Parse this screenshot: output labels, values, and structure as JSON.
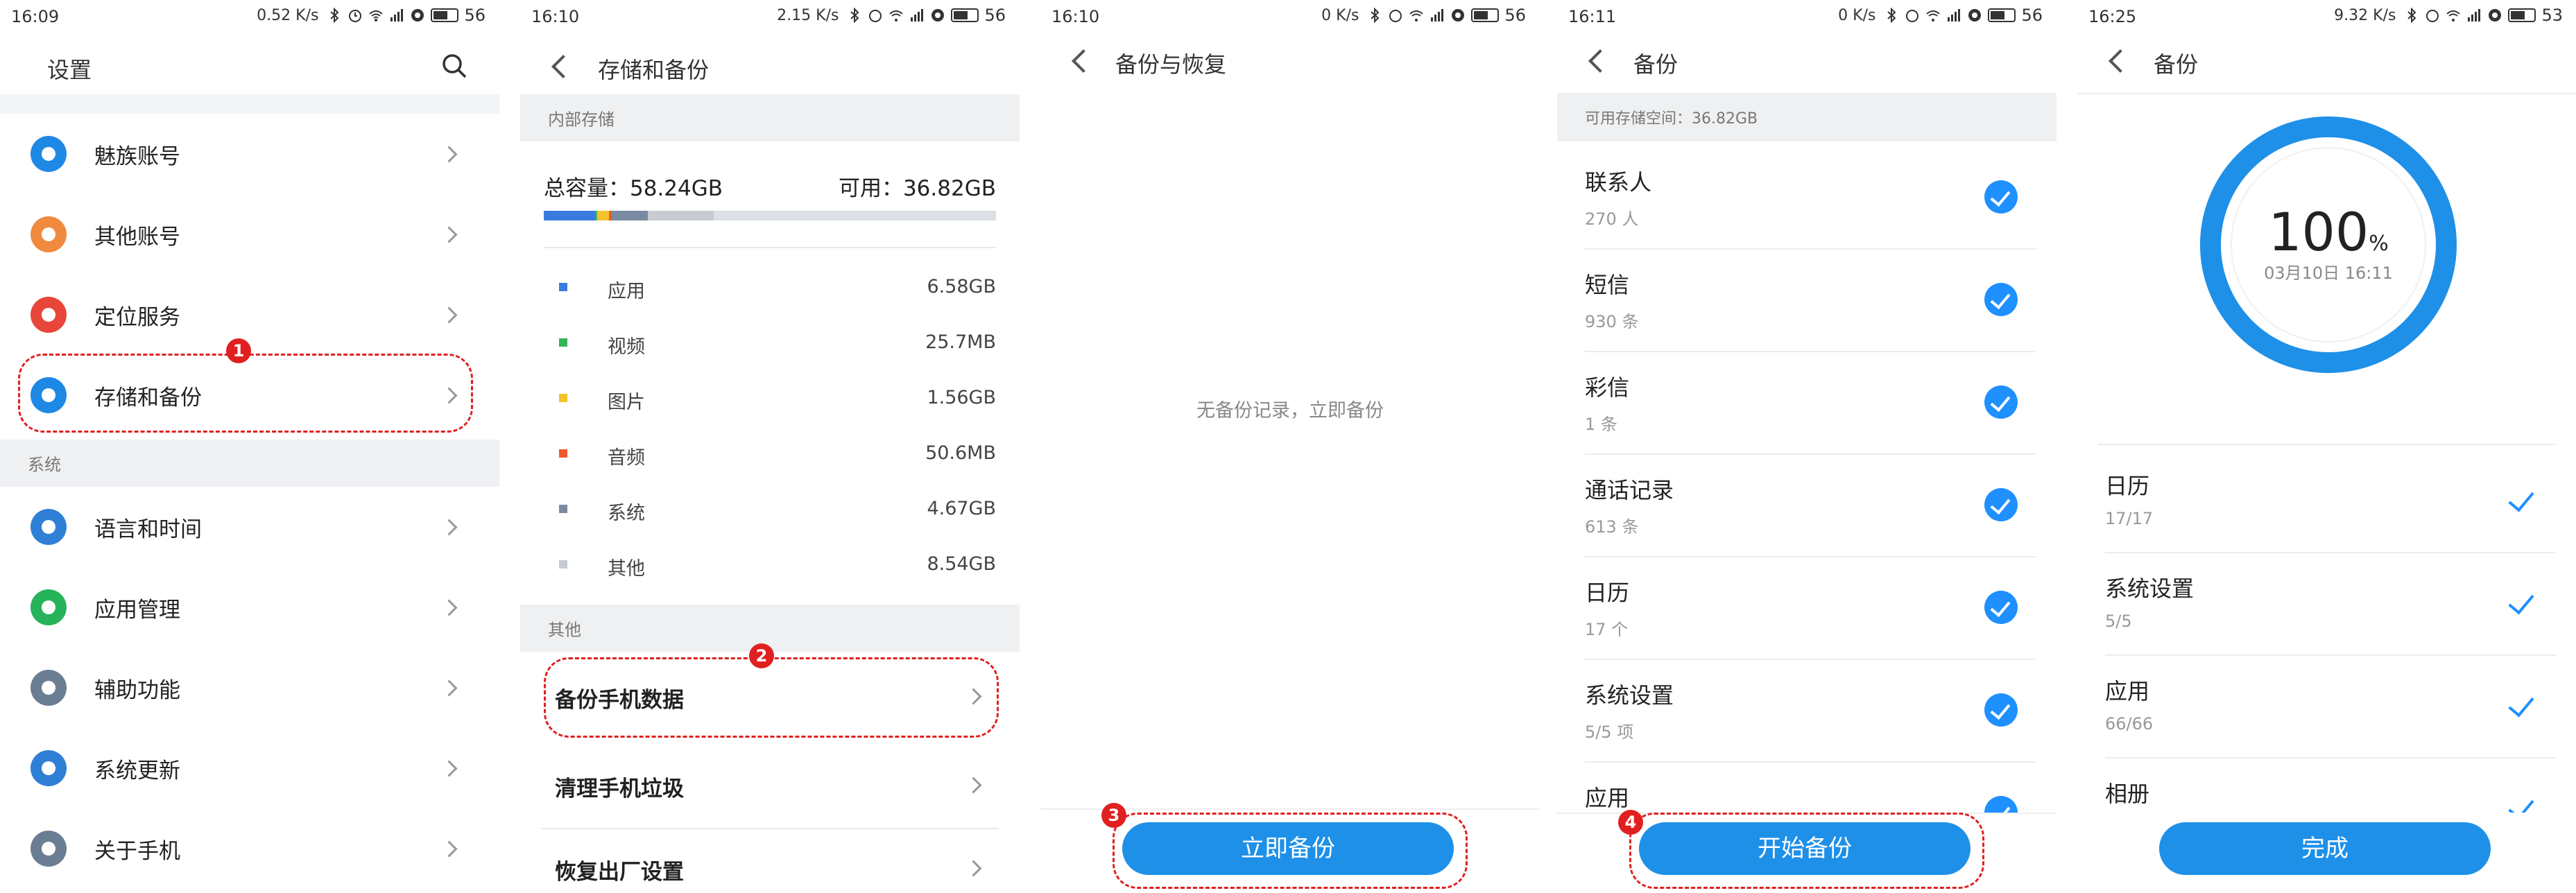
{
  "colors": {
    "accent": "#1e90e8",
    "highlight": "#e02020"
  },
  "panel1": {
    "status": {
      "time": "16:09",
      "net": "0.52 K/s",
      "battery": "56"
    },
    "title": "设置",
    "items": [
      {
        "label": "魅族账号",
        "icon": "meizu-account-icon",
        "color": "#1e88e5"
      },
      {
        "label": "其他账号",
        "icon": "person-icon",
        "color": "#f08a3e"
      },
      {
        "label": "定位服务",
        "icon": "location-pin-icon",
        "color": "#e8463a"
      },
      {
        "label": "存储和备份",
        "icon": "cloud-icon",
        "color": "#1e88e5"
      },
      {
        "label": "语言和时间",
        "icon": "globe-icon",
        "color": "#2f7fd6"
      },
      {
        "label": "应用管理",
        "icon": "app-manage-icon",
        "color": "#27b35a"
      },
      {
        "label": "辅助功能",
        "icon": "hand-pointer-icon",
        "color": "#6b7d92"
      },
      {
        "label": "系统更新",
        "icon": "refresh-icon",
        "color": "#2f7fd6"
      },
      {
        "label": "关于手机",
        "icon": "info-icon",
        "color": "#6b7d92"
      }
    ],
    "section_system": "系统",
    "badge": "1"
  },
  "panel2": {
    "status": {
      "time": "16:10",
      "net": "2.15 K/s",
      "battery": "56"
    },
    "title": "存储和备份",
    "section_internal": "内部存储",
    "total": "总容量：58.24GB",
    "available": "可用：36.82GB",
    "usage": [
      {
        "name": "应用",
        "value": "6.58GB",
        "color": "#3a7be0"
      },
      {
        "name": "视频",
        "value": "25.7MB",
        "color": "#34b55a"
      },
      {
        "name": "图片",
        "value": "1.56GB",
        "color": "#f4c22b"
      },
      {
        "name": "音频",
        "value": "50.6MB",
        "color": "#ef5a2e"
      },
      {
        "name": "系统",
        "value": "4.67GB",
        "color": "#7a8aa0"
      },
      {
        "name": "其他",
        "value": "8.54GB",
        "color": "#c8cbd0"
      }
    ],
    "section_other": "其他",
    "other_items": [
      "备份手机数据",
      "清理手机垃圾",
      "恢复出厂设置"
    ],
    "badge": "2"
  },
  "panel3": {
    "status": {
      "time": "16:10",
      "net": "0 K/s",
      "battery": "56"
    },
    "title": "备份与恢复",
    "empty_text": "无备份记录，立即备份",
    "button": "立即备份",
    "badge": "3"
  },
  "panel4": {
    "status": {
      "time": "16:11",
      "net": "0 K/s",
      "battery": "56"
    },
    "title": "备份",
    "available": "可用存储空间：36.82GB",
    "items": [
      {
        "name": "联系人",
        "count": "270 人"
      },
      {
        "name": "短信",
        "count": "930 条"
      },
      {
        "name": "彩信",
        "count": "1 条"
      },
      {
        "name": "通话记录",
        "count": "613 条"
      },
      {
        "name": "日历",
        "count": "17 个"
      },
      {
        "name": "系统设置",
        "count": "5/5 项"
      },
      {
        "name": "应用",
        "count": ""
      }
    ],
    "button": "开始备份",
    "badge": "4"
  },
  "panel5": {
    "status": {
      "time": "16:25",
      "net": "9.32 K/s",
      "battery": "53"
    },
    "title": "备份",
    "percent": "100",
    "percent_unit": "%",
    "progress": 1.0,
    "date": "03月10日 16:11",
    "items": [
      {
        "name": "日历",
        "count": "17/17"
      },
      {
        "name": "系统设置",
        "count": "5/5"
      },
      {
        "name": "应用",
        "count": "66/66"
      },
      {
        "name": "相册",
        "count": ""
      }
    ],
    "button": "完成"
  }
}
